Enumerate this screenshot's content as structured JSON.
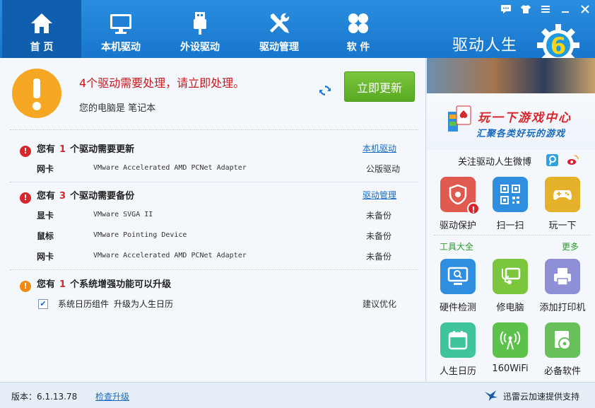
{
  "nav": {
    "items": [
      {
        "label": "首  页",
        "icon": "home-icon"
      },
      {
        "label": "本机驱动",
        "icon": "monitor-icon"
      },
      {
        "label": "外设驱动",
        "icon": "usb-icon"
      },
      {
        "label": "驱动管理",
        "icon": "wrench-screwdriver-icon"
      },
      {
        "label": "软  件",
        "icon": "apps-grid-icon"
      }
    ],
    "active": "首  页",
    "brand": "驱动人生",
    "logo_text": "6"
  },
  "window_controls": [
    "message-icon",
    "skin-icon",
    "menu-icon",
    "minimize-icon"
  ],
  "alert": {
    "message": "4个驱动需要处理，请立即处理。",
    "sub": "您的电脑是 笔记本",
    "update_button": "立即更新"
  },
  "sections": [
    {
      "prefix": "您有",
      "count": "1",
      "suffix": "个驱动需要更新",
      "link": "本机驱动",
      "rows": [
        {
          "type": "网卡",
          "device": "VMware Accelerated AMD PCNet Adapter",
          "status": "公版驱动"
        }
      ]
    },
    {
      "prefix": "您有",
      "count": "3",
      "suffix": "个驱动需要备份",
      "link": "驱动管理",
      "rows": [
        {
          "type": "显卡",
          "device": "VMware SVGA II",
          "status": "未备份"
        },
        {
          "type": "鼠标",
          "device": "VMware Pointing Device",
          "status": "未备份"
        },
        {
          "type": "网卡",
          "device": "VMware Accelerated AMD PCNet Adapter",
          "status": "未备份"
        }
      ]
    },
    {
      "prefix": "您有",
      "count": "1",
      "suffix": "个系统增强功能可以升级",
      "rows": [
        {
          "checked": true,
          "component": "系统日历组件",
          "action": "升级为人生日历",
          "status": "建议优化"
        }
      ]
    }
  ],
  "side": {
    "banner": {
      "line1": "玩一下游戏中心",
      "line2": "汇聚各类好玩的游戏"
    },
    "follow": "关注驱动人生微博",
    "top_tiles": [
      {
        "label": "驱动保护",
        "icon": "shield-gear-icon",
        "color": "#e05a4f"
      },
      {
        "label": "扫一扫",
        "icon": "qr-code-icon",
        "color": "#2f8ee0"
      },
      {
        "label": "玩一下",
        "icon": "gamepad-icon",
        "color": "#e6b12a"
      }
    ],
    "tools_title": "工具大全",
    "more": "更多",
    "tools": [
      {
        "label": "硬件检测",
        "icon": "hardware-scan-icon",
        "color": "#2f8ee0"
      },
      {
        "label": "修电脑",
        "icon": "stethoscope-icon",
        "color": "#7cc63d"
      },
      {
        "label": "添加打印机",
        "icon": "printer-icon",
        "color": "#8e8fd6"
      },
      {
        "label": "人生日历",
        "icon": "calendar-icon",
        "color": "#3fc49d"
      },
      {
        "label": "160WiFi",
        "icon": "wifi-antenna-icon",
        "color": "#5cc24b"
      },
      {
        "label": "必备软件",
        "icon": "disc-icon",
        "color": "#68c05c"
      }
    ]
  },
  "footer": {
    "version": "版本：6.1.13.78",
    "check_update": "检查升级",
    "support": "迅雷云加速提供支持"
  }
}
